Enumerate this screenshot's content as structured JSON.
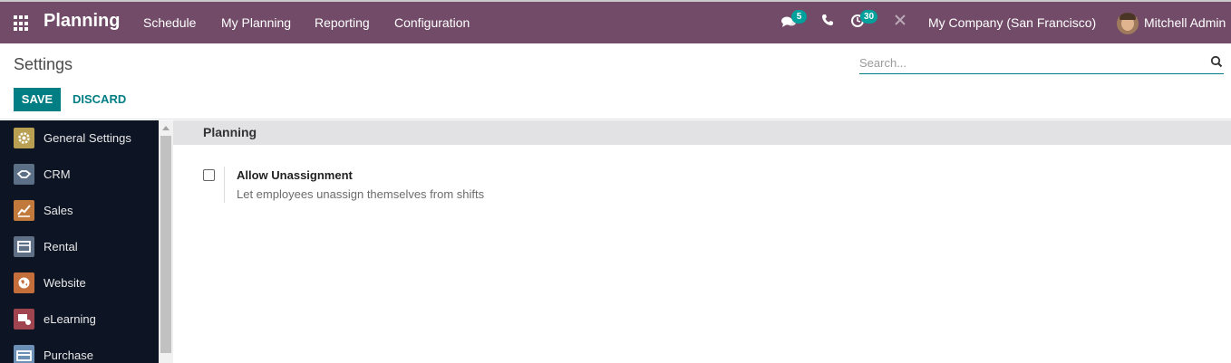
{
  "app": {
    "name": "Planning"
  },
  "menu": [
    "Schedule",
    "My Planning",
    "Reporting",
    "Configuration"
  ],
  "systray": {
    "messages_count": "5",
    "activities_count": "30",
    "company": "My Company (San Francisco)",
    "user": "Mitchell Admin"
  },
  "control_panel": {
    "title": "Settings",
    "search_placeholder": "Search...",
    "save_label": "SAVE",
    "discard_label": "DISCARD"
  },
  "sidebar": {
    "items": [
      {
        "label": "General Settings",
        "icon": "gear-icon",
        "color": "#b89f52"
      },
      {
        "label": "CRM",
        "icon": "handshake-icon",
        "color": "#5b6f86"
      },
      {
        "label": "Sales",
        "icon": "chart-line-icon",
        "color": "#c17a3c"
      },
      {
        "label": "Rental",
        "icon": "rental-icon",
        "color": "#5f6f85"
      },
      {
        "label": "Website",
        "icon": "globe-icon",
        "color": "#c46e3b"
      },
      {
        "label": "eLearning",
        "icon": "elearning-icon",
        "color": "#a04550"
      },
      {
        "label": "Purchase",
        "icon": "credit-card-icon",
        "color": "#6b8fb5"
      }
    ]
  },
  "section": {
    "title": "Planning",
    "setting": {
      "name": "Allow Unassignment",
      "description": "Let employees unassign themselves from shifts",
      "checked": false
    }
  },
  "colors": {
    "navbar": "#714b67",
    "primary": "#017e84",
    "sidebar": "#0d1424",
    "badge": "#00a09d"
  }
}
